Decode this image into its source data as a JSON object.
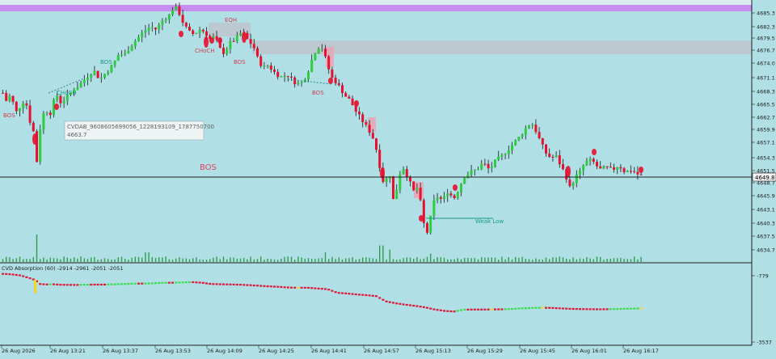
{
  "colors": {
    "background": "#b0dfe5",
    "bull_candle": "#2ecc40",
    "bear_candle": "#e8102e",
    "wick": "#1a1a1a",
    "zone": "#c0c5cc",
    "premium_band": "#c58ef0",
    "bos_text": "#e04060",
    "weak_low": "#1a9a8a",
    "price_line": "#202020",
    "price_box": "#f2f2f2",
    "osc_up": "#3ddc50",
    "osc_down": "#e01838",
    "osc_neutral": "#ffd21a"
  },
  "labels": {
    "chart_label_eqh": "EQH",
    "chart_label_choch_top": "CHoCH",
    "chart_label_bos_1": "BOS",
    "chart_label_bos_2": "BOS",
    "chart_label_bos_3": "BOS",
    "chart_label_bos_4": "BOS",
    "chart_label_choch_left": "CHoCH",
    "chart_label_big_bos": "BOS",
    "weak_low": "Weak Low",
    "tooltip_line1": "CVDAB_9608605699056_1228193109_1787750700",
    "tooltip_line2": "4663.7",
    "current_price": "4649.8",
    "osc_title": "CVD Absorption (60) -2914 -2961 -2051 -2051"
  },
  "chart_data": [
    {
      "type": "candlestick",
      "title": "",
      "price_axis_ticks": [
        "4685.3",
        "4682.3",
        "4679.5",
        "4676.7",
        "4674.0",
        "4671.1",
        "4668.3",
        "4665.5",
        "4662.7",
        "4659.9",
        "4657.1",
        "4654.3",
        "4651.5",
        "4648.7",
        "4645.9",
        "4643.1",
        "4640.3",
        "4637.5",
        "4634.7"
      ],
      "time_axis_ticks": [
        "26 Aug 2026",
        "26 Aug 13:21",
        "26 Aug 13:37",
        "26 Aug 13:53",
        "26 Aug 14:09",
        "26 Aug 14:25",
        "26 Aug 14:41",
        "26 Aug 14:57",
        "26 Aug 15:13",
        "26 Aug 15:29",
        "26 Aug 15:45",
        "26 Aug 16:01",
        "26 Aug 16:17"
      ],
      "ylim": [
        4633.0,
        4687.0
      ],
      "current_price": 4649.8,
      "tooltip_value": 4663.7,
      "price_path": [
        [
          0,
          4669.0
        ],
        [
          6,
          4666.5
        ],
        [
          12,
          4667.8
        ],
        [
          18,
          4664.0
        ],
        [
          24,
          4665.5
        ],
        [
          30,
          4667.0
        ],
        [
          34,
          4663.0
        ],
        [
          40,
          4660.0
        ],
        [
          44,
          4653.8
        ],
        [
          48,
          4660.5
        ],
        [
          54,
          4665.0
        ],
        [
          60,
          4663.5
        ],
        [
          68,
          4668.0
        ],
        [
          74,
          4666.0
        ],
        [
          82,
          4667.5
        ],
        [
          90,
          4669.0
        ],
        [
          98,
          4670.0
        ],
        [
          106,
          4671.5
        ],
        [
          114,
          4673.0
        ],
        [
          122,
          4671.0
        ],
        [
          130,
          4672.5
        ],
        [
          138,
          4674.0
        ],
        [
          146,
          4676.5
        ],
        [
          152,
          4676.0
        ],
        [
          160,
          4678.0
        ],
        [
          168,
          4679.5
        ],
        [
          176,
          4681.0
        ],
        [
          184,
          4682.0
        ],
        [
          192,
          4681.5
        ],
        [
          200,
          4683.5
        ],
        [
          208,
          4684.5
        ],
        [
          214,
          4686.5
        ],
        [
          220,
          4685.0
        ],
        [
          226,
          4682.5
        ],
        [
          232,
          4681.0
        ],
        [
          238,
          4680.5
        ],
        [
          246,
          4681.5
        ],
        [
          252,
          4681.0
        ],
        [
          258,
          4679.5
        ],
        [
          264,
          4680.0
        ],
        [
          270,
          4677.5
        ],
        [
          276,
          4676.5
        ],
        [
          282,
          4678.5
        ],
        [
          290,
          4679.5
        ],
        [
          298,
          4681.0
        ],
        [
          306,
          4679.0
        ],
        [
          312,
          4678.0
        ],
        [
          318,
          4675.0
        ],
        [
          324,
          4673.5
        ],
        [
          330,
          4674.0
        ],
        [
          338,
          4672.5
        ],
        [
          346,
          4671.5
        ],
        [
          354,
          4672.0
        ],
        [
          362,
          4670.5
        ],
        [
          370,
          4670.0
        ],
        [
          378,
          4672.0
        ],
        [
          384,
          4675.0
        ],
        [
          390,
          4677.5
        ],
        [
          396,
          4678.0
        ],
        [
          402,
          4675.0
        ],
        [
          408,
          4671.5
        ],
        [
          414,
          4670.5
        ],
        [
          420,
          4669.0
        ],
        [
          426,
          4667.5
        ],
        [
          432,
          4666.5
        ],
        [
          438,
          4664.5
        ],
        [
          444,
          4663.0
        ],
        [
          450,
          4661.5
        ],
        [
          456,
          4660.0
        ],
        [
          462,
          4658.0
        ],
        [
          468,
          4653.0
        ],
        [
          474,
          4648.5
        ],
        [
          480,
          4652.0
        ],
        [
          486,
          4644.5
        ],
        [
          492,
          4651.0
        ],
        [
          498,
          4652.5
        ],
        [
          504,
          4650.0
        ],
        [
          510,
          4647.5
        ],
        [
          516,
          4648.5
        ],
        [
          522,
          4641.0
        ],
        [
          528,
          4638.5
        ],
        [
          534,
          4645.0
        ],
        [
          540,
          4646.5
        ],
        [
          546,
          4645.5
        ],
        [
          552,
          4647.5
        ],
        [
          560,
          4646.0
        ],
        [
          566,
          4648.0
        ],
        [
          572,
          4650.5
        ],
        [
          580,
          4651.5
        ],
        [
          588,
          4652.0
        ],
        [
          596,
          4653.5
        ],
        [
          604,
          4652.0
        ],
        [
          612,
          4654.0
        ],
        [
          620,
          4655.0
        ],
        [
          628,
          4656.5
        ],
        [
          636,
          4658.0
        ],
        [
          644,
          4659.5
        ],
        [
          650,
          4661.0
        ],
        [
          656,
          4662.0
        ],
        [
          662,
          4660.0
        ],
        [
          668,
          4657.5
        ],
        [
          674,
          4655.5
        ],
        [
          680,
          4654.5
        ],
        [
          686,
          4655.0
        ],
        [
          692,
          4653.0
        ],
        [
          698,
          4651.0
        ],
        [
          704,
          4648.0
        ],
        [
          710,
          4650.5
        ],
        [
          716,
          4651.5
        ],
        [
          722,
          4653.5
        ],
        [
          728,
          4654.0
        ],
        [
          734,
          4653.5
        ],
        [
          740,
          4652.0
        ],
        [
          748,
          4652.5
        ],
        [
          756,
          4652.0
        ],
        [
          764,
          4653.0
        ],
        [
          772,
          4651.5
        ],
        [
          780,
          4652.0
        ],
        [
          788,
          4651.0
        ],
        [
          794,
          4650.5
        ]
      ],
      "volume_peaks": [
        {
          "x": 43,
          "volume": 1.0
        },
        {
          "x": 180,
          "volume": 0.35
        },
        {
          "x": 400,
          "volume": 0.35
        },
        {
          "x": 470,
          "volume": 0.6
        },
        {
          "x": 480,
          "volume": 0.45
        },
        {
          "x": 530,
          "volume": 0.3
        }
      ]
    },
    {
      "type": "line",
      "title": "CVD Absorption (60) -2914 -2961 -2051 -2051",
      "y_axis_ticks": [
        "-779",
        "-3537"
      ],
      "ylim": [
        -3800,
        -600
      ],
      "series": [
        {
          "values": [
            [
              0,
              -890
            ],
            [
              12,
              -910
            ],
            [
              24,
              -960
            ],
            [
              36,
              -1080
            ],
            [
              42,
              -1150
            ],
            [
              48,
              -1320
            ],
            [
              56,
              -1340
            ],
            [
              64,
              -1330
            ],
            [
              72,
              -1350
            ],
            [
              80,
              -1355
            ],
            [
              92,
              -1360
            ],
            [
              104,
              -1350
            ],
            [
              116,
              -1345
            ],
            [
              128,
              -1345
            ],
            [
              140,
              -1330
            ],
            [
              152,
              -1320
            ],
            [
              164,
              -1305
            ],
            [
              176,
              -1300
            ],
            [
              188,
              -1290
            ],
            [
              200,
              -1270
            ],
            [
              212,
              -1265
            ],
            [
              224,
              -1255
            ],
            [
              236,
              -1240
            ],
            [
              248,
              -1265
            ],
            [
              260,
              -1320
            ],
            [
              272,
              -1330
            ],
            [
              284,
              -1340
            ],
            [
              296,
              -1350
            ],
            [
              308,
              -1370
            ],
            [
              320,
              -1395
            ],
            [
              332,
              -1420
            ],
            [
              344,
              -1440
            ],
            [
              356,
              -1470
            ],
            [
              368,
              -1475
            ],
            [
              380,
              -1480
            ],
            [
              392,
              -1510
            ],
            [
              404,
              -1540
            ],
            [
              416,
              -1690
            ],
            [
              428,
              -1720
            ],
            [
              440,
              -1760
            ],
            [
              452,
              -1790
            ],
            [
              464,
              -1830
            ],
            [
              476,
              -2050
            ],
            [
              488,
              -2130
            ],
            [
              500,
              -2190
            ],
            [
              512,
              -2240
            ],
            [
              524,
              -2300
            ],
            [
              536,
              -2390
            ],
            [
              548,
              -2450
            ],
            [
              560,
              -2480
            ],
            [
              572,
              -2400
            ],
            [
              584,
              -2395
            ],
            [
              596,
              -2395
            ],
            [
              608,
              -2390
            ],
            [
              620,
              -2385
            ],
            [
              632,
              -2370
            ],
            [
              644,
              -2345
            ],
            [
              656,
              -2330
            ],
            [
              668,
              -2320
            ],
            [
              680,
              -2325
            ],
            [
              692,
              -2345
            ],
            [
              704,
              -2365
            ],
            [
              716,
              -2375
            ],
            [
              728,
              -2380
            ],
            [
              740,
              -2385
            ],
            [
              752,
              -2380
            ],
            [
              764,
              -2370
            ],
            [
              776,
              -2360
            ],
            [
              788,
              -2350
            ],
            [
              794,
              -2350
            ]
          ]
        }
      ]
    }
  ]
}
